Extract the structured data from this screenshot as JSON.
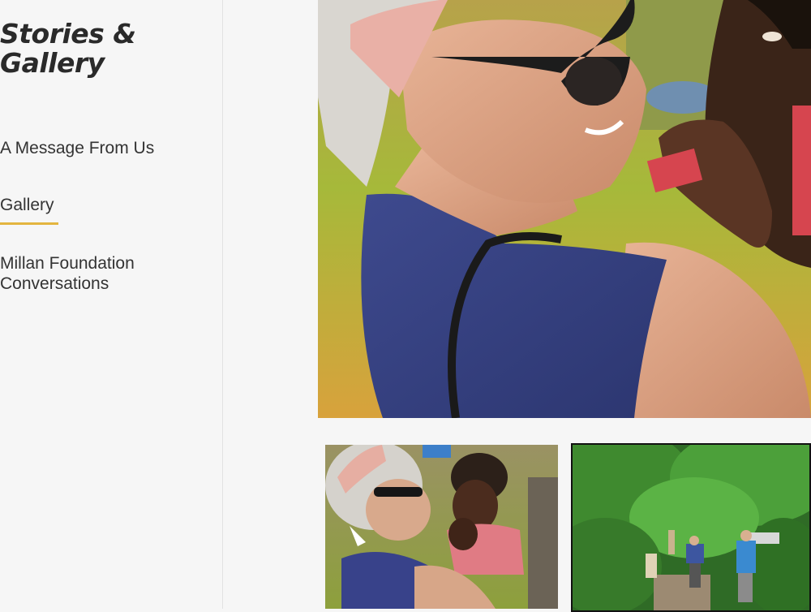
{
  "sidebar": {
    "title": "Stories & Gallery",
    "items": [
      {
        "label": "A Message From Us",
        "active": false
      },
      {
        "label": "Gallery",
        "active": true
      },
      {
        "label": "Millan Foundation Conversations",
        "active": false
      }
    ],
    "accent_color": "#e3b53f"
  },
  "gallery": {
    "photos": [
      {
        "subject": "woman in sunglasses and pink headband holding child"
      },
      {
        "subject": "woman holding child, smaller view"
      },
      {
        "subject": "volunteers working in green vegetation"
      }
    ]
  }
}
